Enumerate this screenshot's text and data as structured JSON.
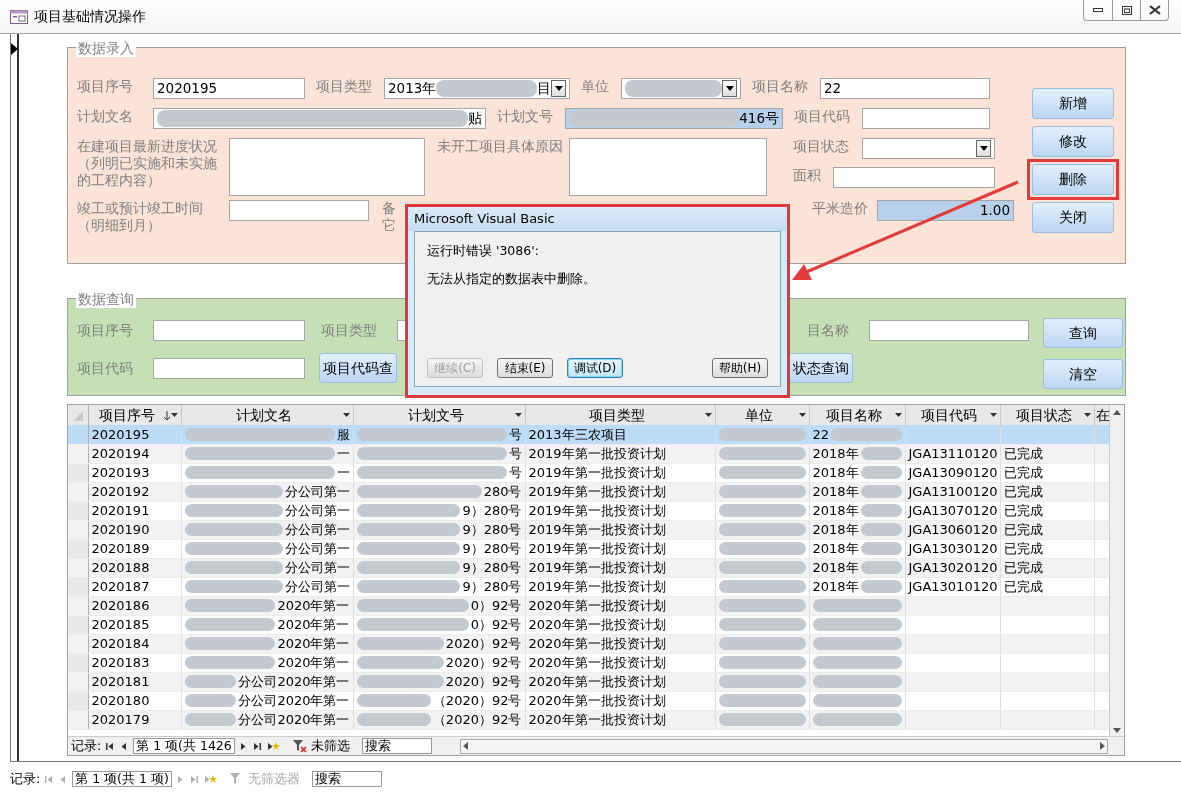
{
  "window": {
    "title": "项目基础情况操作"
  },
  "entry": {
    "legend": "数据录入",
    "rows": [
      [
        {
          "label": "项目序号",
          "kind": "text",
          "value": "2020195"
        },
        {
          "label": "项目类型",
          "kind": "select",
          "value": "2013年",
          "tail": "目",
          "blurred": true
        },
        {
          "label": "单位",
          "kind": "select",
          "blurred": true
        },
        {
          "label": "项目名称",
          "kind": "text",
          "value": "22"
        }
      ],
      [
        {
          "label": "计划文名",
          "kind": "text",
          "tail": "贴",
          "blurred": true
        },
        {
          "label": "计划文号",
          "kind": "readonly",
          "tail": "416号",
          "blurred": true
        },
        {
          "label": "项目代码",
          "kind": "text"
        }
      ],
      [
        {
          "label": "在建项目最新进度状况（列明已实施和未实施的工程内容）",
          "kind": "memo"
        },
        {
          "label": "未开工项目具体原因",
          "kind": "memo"
        },
        {
          "label": "项目状态",
          "kind": "select"
        },
        {
          "label": "面积",
          "kind": "text"
        }
      ],
      [
        {
          "label": "竣工或预计竣工时间（明细到月）",
          "kind": "text"
        },
        {
          "label": "备它",
          "kind": "covered"
        },
        {
          "label": "平米造价",
          "kind": "readonly",
          "value": "1.00"
        }
      ]
    ],
    "buttons": [
      {
        "label": "新增",
        "highlighted": false
      },
      {
        "label": "修改",
        "highlighted": false
      },
      {
        "label": "删除",
        "highlighted": true
      },
      {
        "label": "关闭",
        "highlighted": false
      }
    ]
  },
  "query": {
    "legend": "数据查询",
    "fields": [
      {
        "label": "项目序号"
      },
      {
        "label": "项目类型"
      },
      {
        "label": "目名称"
      },
      {
        "label": "项目代码"
      }
    ],
    "buttons": [
      {
        "label": "项目代码查"
      },
      {
        "label": "状态查询"
      },
      {
        "label": "查询"
      },
      {
        "label": "清空"
      }
    ]
  },
  "table": {
    "columns": [
      {
        "label": "项目序号"
      },
      {
        "label": "计划文名",
        "blurred": true,
        "blur_after": false
      },
      {
        "label": "计划文号",
        "blurred": true,
        "blur_after": false
      },
      {
        "label": "项目类型"
      },
      {
        "label": "单位",
        "blurred": true,
        "blur_after": false
      },
      {
        "label": "项目名称",
        "blurred": true,
        "blur_after": true
      },
      {
        "label": "项目代码"
      },
      {
        "label": "项目状态"
      },
      {
        "label": "在"
      }
    ],
    "rows": [
      {
        "selected": true,
        "cells": [
          "2020195",
          "服",
          "号",
          "2013年三农项目",
          "",
          "22",
          "",
          ""
        ]
      },
      {
        "selected": false,
        "cells": [
          "2020194",
          "一",
          "号",
          "2019年第一批投资计划",
          "",
          "2018年",
          "JGA13110120",
          "已完成"
        ]
      },
      {
        "selected": false,
        "cells": [
          "2020193",
          "一",
          "号",
          "2019年第一批投资计划",
          "",
          "2018年",
          "JGA13090120",
          "已完成"
        ]
      },
      {
        "selected": false,
        "cells": [
          "2020192",
          "分公司第一",
          "280号",
          "2019年第一批投资计划",
          "",
          "2018年",
          "JGA13100120",
          "已完成"
        ]
      },
      {
        "selected": false,
        "cells": [
          "2020191",
          "分公司第一",
          "9）280号",
          "2019年第一批投资计划",
          "",
          "2018年",
          "JGA13070120",
          "已完成"
        ]
      },
      {
        "selected": false,
        "cells": [
          "2020190",
          "分公司第一",
          "9）280号",
          "2019年第一批投资计划",
          "",
          "2018年",
          "JGA13060120",
          "已完成"
        ]
      },
      {
        "selected": false,
        "cells": [
          "2020189",
          "分公司第一",
          "9）280号",
          "2019年第一批投资计划",
          "",
          "2018年",
          "JGA13030120",
          "已完成"
        ]
      },
      {
        "selected": false,
        "cells": [
          "2020188",
          "分公司第一",
          "9）280号",
          "2019年第一批投资计划",
          "",
          "2018年",
          "JGA13020120",
          "已完成"
        ]
      },
      {
        "selected": false,
        "cells": [
          "2020187",
          "分公司第一",
          "9）280号",
          "2019年第一批投资计划",
          "",
          "2018年",
          "JGA13010120",
          "已完成"
        ]
      },
      {
        "selected": false,
        "cells": [
          "2020186",
          "2020年第一",
          "0）92号",
          "2020年第一批投资计划",
          "",
          "",
          "",
          ""
        ]
      },
      {
        "selected": false,
        "cells": [
          "2020185",
          "2020年第一",
          "0）92号",
          "2020年第一批投资计划",
          "",
          "",
          "",
          ""
        ]
      },
      {
        "selected": false,
        "cells": [
          "2020184",
          "2020年第一",
          "2020）92号",
          "2020年第一批投资计划",
          "",
          "",
          "",
          ""
        ]
      },
      {
        "selected": false,
        "cells": [
          "2020183",
          "2020年第一",
          "2020）92号",
          "2020年第一批投资计划",
          "",
          "",
          "",
          ""
        ]
      },
      {
        "selected": false,
        "cells": [
          "2020181",
          "分公司2020年第一",
          "2020）92号",
          "2020年第一批投资计划",
          "",
          "",
          "",
          ""
        ]
      },
      {
        "selected": false,
        "cells": [
          "2020180",
          "分公司2020年第一",
          "（2020）92号",
          "2020年第一批投资计划",
          "",
          "",
          "",
          ""
        ]
      },
      {
        "selected": false,
        "cells": [
          "2020179",
          "分公司2020年第一",
          "（2020）92号",
          "2020年第一批投资计划",
          "",
          "",
          "",
          ""
        ]
      }
    ],
    "navigation": {
      "label": "记录:",
      "position": "第 1 项(共 1426",
      "filter": "未筛选",
      "filter_disabled": false,
      "search": "搜索"
    }
  },
  "form_navigation": {
    "label": "记录:",
    "position": "第 1 项(共 1 项)",
    "filter": "无筛选器",
    "filter_disabled": true,
    "search": "搜索"
  },
  "dialog": {
    "title": "Microsoft Visual Basic",
    "messages": [
      "运行时错误 '3086':",
      "无法从指定的数据表中删除。"
    ],
    "buttons": [
      {
        "label": "继续(C)",
        "disabled": true,
        "selected": false
      },
      {
        "label": "结束(E)",
        "disabled": false,
        "selected": false
      },
      {
        "label": "调试(D)",
        "disabled": false,
        "selected": true
      },
      {
        "label": "帮助(H)",
        "disabled": false,
        "selected": false
      }
    ]
  }
}
